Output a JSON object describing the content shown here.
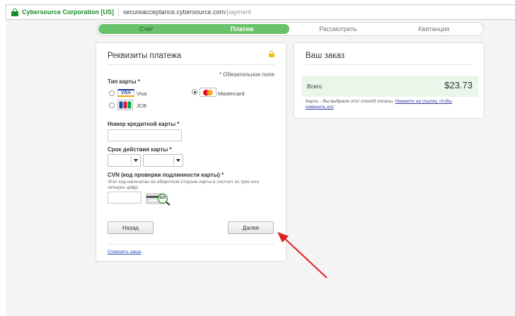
{
  "browser": {
    "site_identity": "Cybersource Corporation [US]",
    "url_host": "secureacceptance.cybersource.com",
    "url_path": "/payment"
  },
  "steps": [
    {
      "label": "Счет",
      "state": "done"
    },
    {
      "label": "Платеж",
      "state": "active"
    },
    {
      "label": "Рассмотреть",
      "state": "pending"
    },
    {
      "label": "Квитанция",
      "state": "pending"
    }
  ],
  "payment": {
    "title": "Реквизиты платежа",
    "required_note": "* Обязательное поле",
    "card_type_label": "Тип карты *",
    "card_types": [
      {
        "name": "Visa",
        "badge": "VISA",
        "selected": false
      },
      {
        "name": "Mastercard",
        "badge": "MC",
        "selected": true
      },
      {
        "name": "JCB",
        "badge": "JCB",
        "selected": false
      }
    ],
    "card_number_label": "Номер кредитной карты *",
    "card_number_value": "",
    "expiry_label": "Срок действия карты *",
    "expiry_month_value": "",
    "expiry_year_value": "",
    "cvn_label": "CVN (код проверки подлинности карты) *",
    "cvn_help": "Этот код напечатан на оборотной стороне карты и состоит из трех или четырех цифр.",
    "cvn_value": "",
    "cvn_example": "123",
    "back_button": "Назад",
    "next_button": "Далее",
    "cancel_link": "Отменить заказ"
  },
  "order": {
    "title": "Ваш заказ",
    "total_label": "Всего",
    "total_value": "$23.73",
    "note_text": "Карта – Вы выбрали этот способ оплаты.",
    "note_link": "Нажмите на ссылку, чтобы изменить его"
  },
  "colors": {
    "accent_green": "#6ac26a",
    "secure_green": "#1e8a2e",
    "arrow_red": "#e02020",
    "link_blue": "#2a4bb8"
  }
}
